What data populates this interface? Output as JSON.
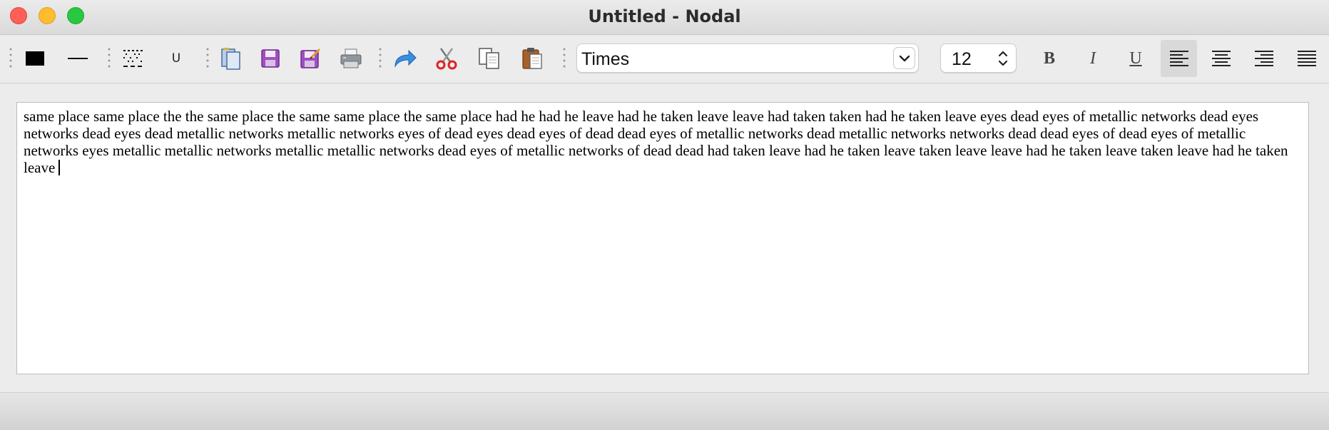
{
  "window": {
    "title": "Untitled - Nodal"
  },
  "toolbar": {
    "icons": [
      "fill-color-icon",
      "line-style-icon",
      "dotted-pattern-icon",
      "underline-style-icon",
      "new-document-icon",
      "save-icon",
      "save-as-icon",
      "print-icon",
      "redo-icon",
      "cut-icon",
      "copy-icon",
      "paste-icon",
      "bold-icon",
      "italic-icon",
      "underline-icon",
      "align-left-icon",
      "align-center-icon",
      "align-right-icon",
      "justify-icon"
    ],
    "style_u_label": "U",
    "font_family": "Times",
    "font_size": "12",
    "bold_label": "B",
    "italic_label": "I",
    "underline_label": "U",
    "active_alignment": "left"
  },
  "editor": {
    "text": "same place same place the the same place the same same place the same place had he had he leave had he taken leave leave had taken taken had he taken leave eyes dead eyes of metallic networks dead eyes networks dead eyes dead metallic networks metallic networks eyes of dead eyes dead eyes of dead dead eyes of metallic networks dead metallic networks networks dead dead eyes of dead eyes of metallic networks eyes metallic metallic networks metallic metallic networks dead eyes of metallic networks of dead dead had taken leave had he taken leave taken leave leave had he taken leave taken leave had he taken leave"
  },
  "colors": {
    "close": "#fe5f57",
    "minimize": "#febc2e",
    "maximize": "#28c840"
  }
}
